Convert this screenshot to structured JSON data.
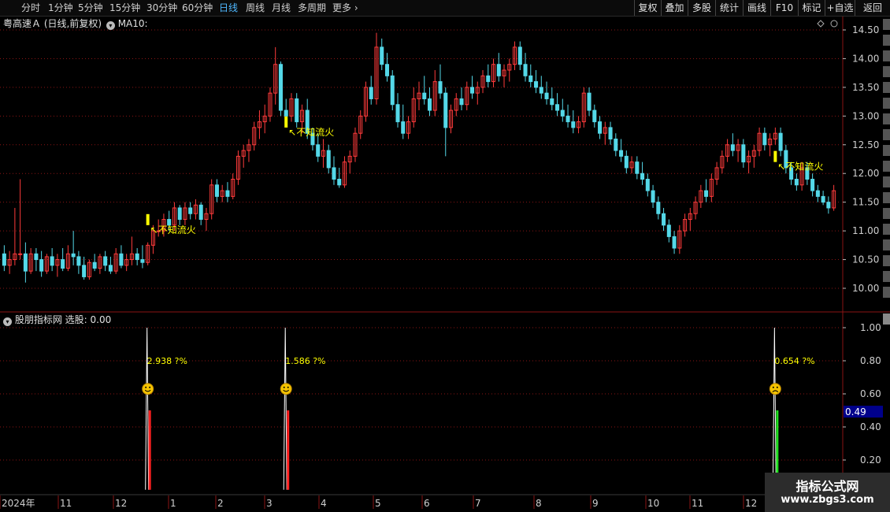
{
  "toolbar": {
    "left": [
      "分时",
      "1分钟",
      "5分钟",
      "15分钟",
      "30分钟",
      "60分钟",
      "日线",
      "周线",
      "月线",
      "多周期",
      "更多"
    ],
    "active": "日线",
    "right": [
      "复权",
      "叠加",
      "多股",
      "统计",
      "画线",
      "F10",
      "标记",
      "+自选",
      "返回"
    ]
  },
  "main": {
    "title": "粤高速Ａ",
    "period": "(日线,前复权)",
    "ma_label": "MA10:",
    "price_ticks": [
      "14.50",
      "14.00",
      "13.50",
      "13.00",
      "12.50",
      "12.00",
      "11.50",
      "11.00",
      "10.50",
      "10.00"
    ],
    "annotation": "↖不知流火"
  },
  "indicator": {
    "name": "股朋指标网",
    "label": "选股: 0.00",
    "ticks": [
      "1.00",
      "0.80",
      "0.60",
      "0.40",
      "0.20"
    ],
    "current_value": "0.49",
    "markers": [
      {
        "text": "2.938  ?%",
        "face": "smile"
      },
      {
        "text": "1.586  ?%",
        "face": "smile"
      },
      {
        "text": "0.654  ?%",
        "face": "frown"
      }
    ]
  },
  "timeline": {
    "labels": [
      "2024年",
      "11",
      "12",
      "1",
      "2",
      "3",
      "4",
      "5",
      "6",
      "7",
      "8",
      "9",
      "10",
      "11",
      "12"
    ]
  },
  "watermark": {
    "line1": "指标公式网",
    "line2": "www.zbgs3.com"
  },
  "colors": {
    "up": "#ff3b3b",
    "down": "#54d8e8",
    "annotation": "#ffff00",
    "active": "#4fb8ff",
    "grid": "#8a1414"
  },
  "chart_data": {
    "type": "candlestick",
    "ylim": [
      9.8,
      14.6
    ],
    "candles": [
      [
        10.6,
        10.75,
        10.3,
        10.4
      ],
      [
        10.4,
        10.65,
        10.25,
        10.5
      ],
      [
        10.5,
        11.4,
        10.4,
        10.6
      ],
      [
        10.6,
        11.9,
        10.5,
        10.6
      ],
      [
        10.6,
        10.8,
        10.1,
        10.3
      ],
      [
        10.3,
        10.7,
        10.25,
        10.6
      ],
      [
        10.6,
        10.7,
        10.3,
        10.5
      ],
      [
        10.5,
        10.65,
        10.2,
        10.3
      ],
      [
        10.3,
        10.6,
        10.25,
        10.55
      ],
      [
        10.55,
        10.7,
        10.3,
        10.4
      ],
      [
        10.4,
        10.6,
        10.2,
        10.5
      ],
      [
        10.5,
        10.7,
        10.3,
        10.35
      ],
      [
        10.35,
        10.75,
        10.3,
        10.6
      ],
      [
        10.6,
        11.0,
        10.4,
        10.55
      ],
      [
        10.55,
        10.65,
        10.25,
        10.4
      ],
      [
        10.4,
        10.55,
        10.15,
        10.2
      ],
      [
        10.2,
        10.5,
        10.15,
        10.45
      ],
      [
        10.45,
        10.6,
        10.3,
        10.35
      ],
      [
        10.35,
        10.6,
        10.25,
        10.55
      ],
      [
        10.55,
        10.65,
        10.3,
        10.4
      ],
      [
        10.4,
        10.55,
        10.25,
        10.3
      ],
      [
        10.3,
        10.7,
        10.25,
        10.6
      ],
      [
        10.6,
        10.75,
        10.35,
        10.4
      ],
      [
        10.4,
        10.6,
        10.3,
        10.5
      ],
      [
        10.5,
        10.9,
        10.4,
        10.6
      ],
      [
        10.6,
        10.7,
        10.4,
        10.5
      ],
      [
        10.5,
        10.75,
        10.35,
        10.45
      ],
      [
        10.45,
        10.8,
        10.4,
        10.75
      ],
      [
        10.75,
        11.1,
        10.6,
        11.0
      ],
      [
        11.0,
        11.2,
        10.9,
        11.0
      ],
      [
        11.0,
        11.3,
        10.9,
        11.2
      ],
      [
        11.2,
        11.35,
        11.0,
        11.1
      ],
      [
        11.1,
        11.5,
        11.0,
        11.4
      ],
      [
        11.4,
        11.45,
        11.1,
        11.2
      ],
      [
        11.2,
        11.5,
        11.1,
        11.4
      ],
      [
        11.4,
        11.5,
        11.2,
        11.3
      ],
      [
        11.3,
        11.55,
        11.2,
        11.45
      ],
      [
        11.45,
        11.5,
        11.1,
        11.2
      ],
      [
        11.2,
        11.4,
        11.0,
        11.3
      ],
      [
        11.3,
        11.9,
        11.2,
        11.8
      ],
      [
        11.8,
        11.9,
        11.5,
        11.6
      ],
      [
        11.6,
        11.8,
        11.5,
        11.7
      ],
      [
        11.7,
        11.85,
        11.5,
        11.6
      ],
      [
        11.6,
        12.0,
        11.55,
        11.9
      ],
      [
        11.9,
        12.4,
        11.8,
        12.3
      ],
      [
        12.3,
        12.5,
        12.1,
        12.4
      ],
      [
        12.4,
        12.6,
        12.2,
        12.5
      ],
      [
        12.5,
        12.9,
        12.4,
        12.8
      ],
      [
        12.8,
        13.1,
        12.6,
        12.9
      ],
      [
        12.9,
        13.2,
        12.7,
        13.0
      ],
      [
        13.0,
        13.5,
        12.9,
        13.4
      ],
      [
        13.4,
        14.2,
        13.2,
        13.9
      ],
      [
        13.9,
        13.95,
        13.0,
        13.1
      ],
      [
        13.1,
        13.3,
        12.9,
        13.0
      ],
      [
        13.0,
        13.4,
        12.9,
        13.3
      ],
      [
        13.3,
        13.4,
        12.8,
        12.9
      ],
      [
        12.9,
        13.2,
        12.7,
        13.1
      ],
      [
        13.1,
        13.3,
        12.6,
        12.7
      ],
      [
        12.7,
        12.8,
        12.4,
        12.5
      ],
      [
        12.5,
        12.7,
        12.2,
        12.3
      ],
      [
        12.3,
        12.6,
        12.1,
        12.4
      ],
      [
        12.4,
        12.5,
        12.0,
        12.1
      ],
      [
        12.1,
        12.3,
        11.8,
        11.9
      ],
      [
        11.9,
        12.1,
        11.75,
        11.8
      ],
      [
        11.8,
        12.3,
        11.75,
        12.2
      ],
      [
        12.2,
        12.4,
        12.0,
        12.3
      ],
      [
        12.3,
        12.8,
        12.2,
        12.7
      ],
      [
        12.7,
        13.1,
        12.6,
        13.0
      ],
      [
        13.0,
        13.6,
        12.9,
        13.5
      ],
      [
        13.5,
        13.7,
        13.2,
        13.3
      ],
      [
        13.3,
        14.45,
        13.2,
        14.2
      ],
      [
        14.2,
        14.35,
        13.8,
        13.9
      ],
      [
        13.9,
        14.1,
        13.6,
        13.7
      ],
      [
        13.7,
        13.8,
        13.1,
        13.2
      ],
      [
        13.2,
        13.4,
        12.8,
        12.9
      ],
      [
        12.9,
        13.2,
        12.6,
        12.7
      ],
      [
        12.7,
        13.0,
        12.6,
        12.9
      ],
      [
        12.9,
        13.5,
        12.8,
        13.3
      ],
      [
        13.3,
        13.6,
        13.1,
        13.4
      ],
      [
        13.4,
        13.7,
        13.2,
        13.3
      ],
      [
        13.3,
        13.5,
        13.0,
        13.1
      ],
      [
        13.1,
        13.8,
        13.0,
        13.6
      ],
      [
        13.6,
        13.9,
        13.3,
        13.4
      ],
      [
        13.4,
        13.5,
        12.3,
        12.8
      ],
      [
        12.8,
        13.2,
        12.7,
        13.1
      ],
      [
        13.1,
        13.4,
        13.0,
        13.3
      ],
      [
        13.3,
        13.5,
        13.1,
        13.2
      ],
      [
        13.2,
        13.6,
        13.1,
        13.5
      ],
      [
        13.5,
        13.7,
        13.3,
        13.4
      ],
      [
        13.4,
        13.6,
        13.2,
        13.5
      ],
      [
        13.5,
        13.8,
        13.4,
        13.7
      ],
      [
        13.7,
        13.9,
        13.5,
        13.6
      ],
      [
        13.6,
        14.0,
        13.5,
        13.9
      ],
      [
        13.9,
        14.1,
        13.6,
        13.7
      ],
      [
        13.7,
        13.9,
        13.5,
        13.8
      ],
      [
        13.8,
        14.0,
        13.6,
        13.9
      ],
      [
        13.9,
        14.3,
        13.8,
        14.2
      ],
      [
        14.2,
        14.3,
        13.8,
        13.9
      ],
      [
        13.9,
        14.1,
        13.6,
        13.7
      ],
      [
        13.7,
        13.9,
        13.5,
        13.6
      ],
      [
        13.6,
        13.8,
        13.4,
        13.5
      ],
      [
        13.5,
        13.7,
        13.3,
        13.4
      ],
      [
        13.4,
        13.6,
        13.2,
        13.3
      ],
      [
        13.3,
        13.5,
        13.1,
        13.2
      ],
      [
        13.2,
        13.4,
        13.0,
        13.1
      ],
      [
        13.1,
        13.3,
        12.9,
        13.0
      ],
      [
        13.0,
        13.2,
        12.8,
        12.9
      ],
      [
        12.9,
        13.1,
        12.7,
        12.8
      ],
      [
        12.8,
        13.0,
        12.7,
        12.9
      ],
      [
        12.9,
        13.5,
        12.8,
        13.4
      ],
      [
        13.4,
        13.5,
        13.0,
        13.1
      ],
      [
        13.1,
        13.2,
        12.8,
        12.9
      ],
      [
        12.9,
        13.0,
        12.6,
        12.7
      ],
      [
        12.7,
        12.9,
        12.5,
        12.8
      ],
      [
        12.8,
        12.9,
        12.5,
        12.6
      ],
      [
        12.6,
        12.7,
        12.3,
        12.4
      ],
      [
        12.4,
        12.6,
        12.2,
        12.3
      ],
      [
        12.3,
        12.4,
        12.0,
        12.1
      ],
      [
        12.1,
        12.3,
        12.0,
        12.2
      ],
      [
        12.2,
        12.3,
        11.9,
        12.0
      ],
      [
        12.0,
        12.2,
        11.8,
        11.9
      ],
      [
        11.9,
        12.0,
        11.6,
        11.7
      ],
      [
        11.7,
        11.8,
        11.4,
        11.5
      ],
      [
        11.5,
        11.6,
        11.2,
        11.3
      ],
      [
        11.3,
        11.4,
        11.0,
        11.1
      ],
      [
        11.1,
        11.2,
        10.8,
        10.9
      ],
      [
        10.9,
        11.0,
        10.6,
        10.7
      ],
      [
        10.7,
        11.1,
        10.6,
        11.0
      ],
      [
        11.0,
        11.3,
        10.9,
        11.2
      ],
      [
        11.2,
        11.4,
        11.0,
        11.3
      ],
      [
        11.3,
        11.6,
        11.2,
        11.5
      ],
      [
        11.5,
        11.8,
        11.4,
        11.7
      ],
      [
        11.7,
        11.9,
        11.5,
        11.6
      ],
      [
        11.6,
        12.0,
        11.5,
        11.9
      ],
      [
        11.9,
        12.2,
        11.8,
        12.1
      ],
      [
        12.1,
        12.4,
        12.0,
        12.3
      ],
      [
        12.3,
        12.6,
        12.2,
        12.5
      ],
      [
        12.5,
        12.7,
        12.3,
        12.4
      ],
      [
        12.4,
        12.6,
        12.2,
        12.5
      ],
      [
        12.5,
        12.6,
        12.1,
        12.2
      ],
      [
        12.2,
        12.4,
        12.0,
        12.3
      ],
      [
        12.3,
        12.5,
        12.1,
        12.4
      ],
      [
        12.4,
        12.8,
        12.3,
        12.7
      ],
      [
        12.7,
        12.8,
        12.4,
        12.5
      ],
      [
        12.5,
        12.7,
        12.3,
        12.6
      ],
      [
        12.6,
        12.8,
        12.5,
        12.7
      ],
      [
        12.7,
        12.8,
        12.3,
        12.4
      ],
      [
        12.4,
        12.5,
        12.0,
        12.1
      ],
      [
        12.1,
        12.2,
        11.8,
        11.9
      ],
      [
        11.9,
        12.0,
        11.7,
        11.8
      ],
      [
        11.8,
        12.2,
        11.7,
        12.1
      ],
      [
        12.1,
        12.2,
        11.8,
        11.9
      ],
      [
        11.9,
        12.0,
        11.6,
        11.7
      ],
      [
        11.7,
        11.8,
        11.5,
        11.6
      ],
      [
        11.6,
        11.7,
        11.45,
        11.5
      ],
      [
        11.5,
        11.6,
        11.3,
        11.4
      ],
      [
        11.4,
        11.8,
        11.35,
        11.7
      ]
    ],
    "signals": [
      {
        "index": 27,
        "price": 11.1,
        "strength": 2.938
      },
      {
        "index": 53,
        "price": 12.8,
        "strength": 1.586
      },
      {
        "index": 145,
        "price": 12.2,
        "strength": 0.654
      }
    ]
  }
}
